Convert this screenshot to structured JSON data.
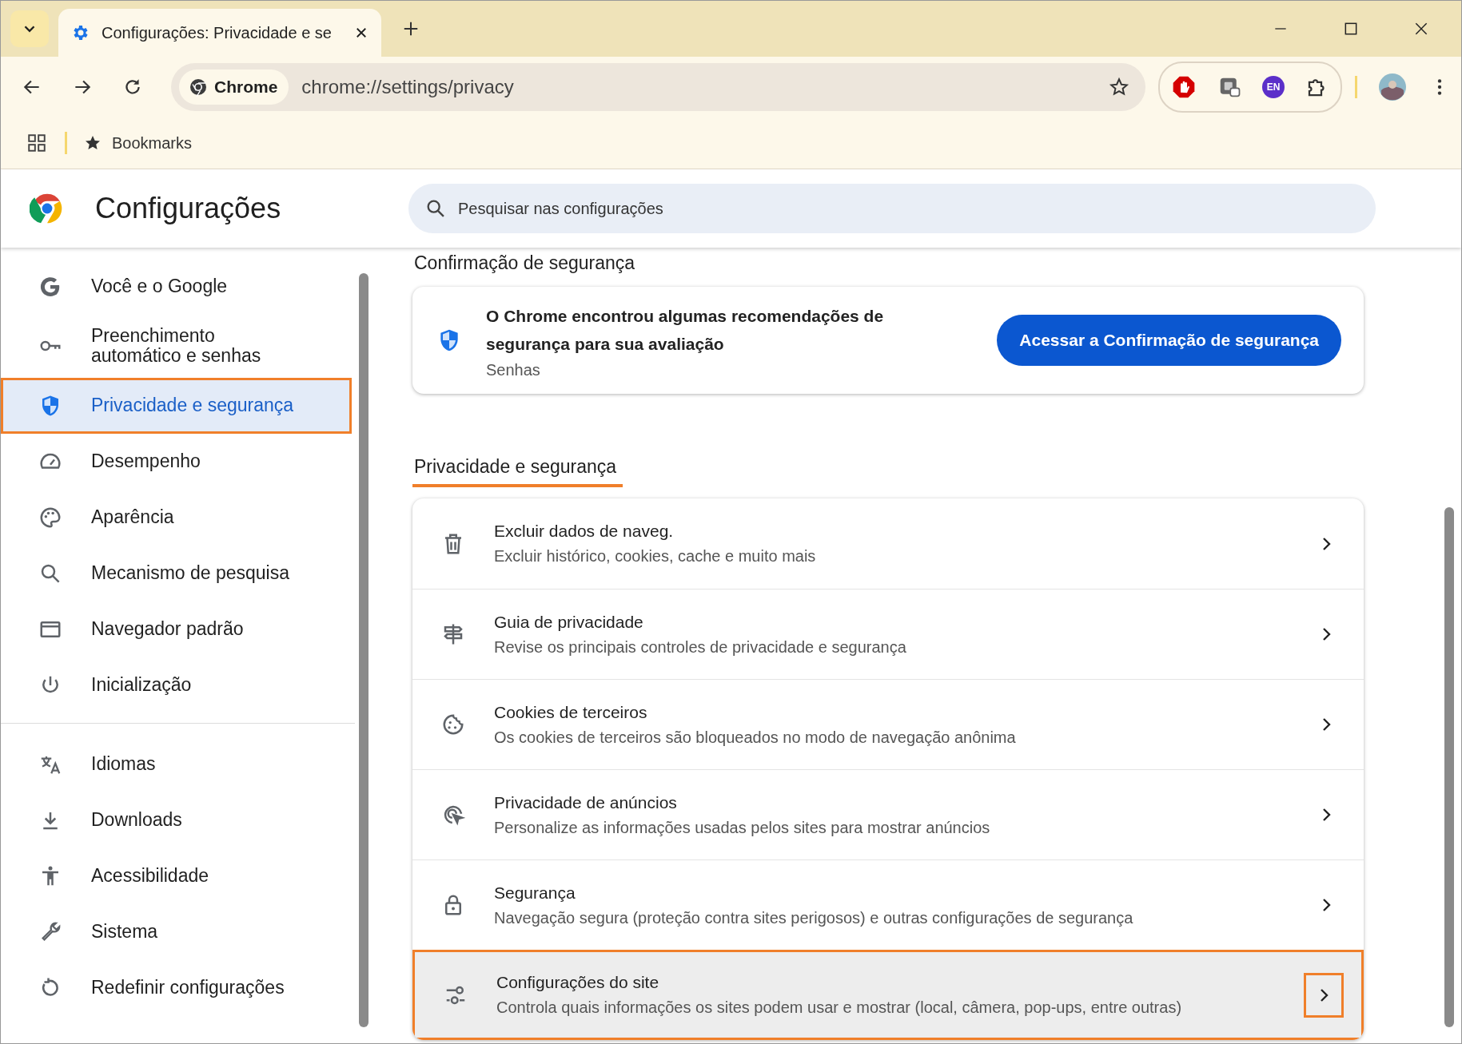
{
  "tab": {
    "title": "Configurações: Privacidade e se"
  },
  "toolbar": {
    "site_chip": "Chrome",
    "url": "chrome://settings/privacy",
    "language_badge": "EN"
  },
  "bookmarks_bar": {
    "label": "Bookmarks"
  },
  "header": {
    "title": "Configurações",
    "search": {
      "placeholder": "Pesquisar nas configurações"
    }
  },
  "sidebar": {
    "groups": [
      {
        "items": [
          {
            "label": "Você e o Google",
            "selected": false,
            "highlighted": false
          },
          {
            "label": "Preenchimento automático e senhas",
            "selected": false,
            "highlighted": false
          },
          {
            "label": "Privacidade e segurança",
            "selected": true,
            "highlighted": true
          },
          {
            "label": "Desempenho",
            "selected": false,
            "highlighted": false
          },
          {
            "label": "Aparência",
            "selected": false,
            "highlighted": false
          },
          {
            "label": "Mecanismo de pesquisa",
            "selected": false,
            "highlighted": false
          },
          {
            "label": "Navegador padrão",
            "selected": false,
            "highlighted": false
          },
          {
            "label": "Inicialização",
            "selected": false,
            "highlighted": false
          }
        ]
      },
      {
        "items": [
          {
            "label": "Idiomas",
            "selected": false,
            "highlighted": false
          },
          {
            "label": "Downloads",
            "selected": false,
            "highlighted": false
          },
          {
            "label": "Acessibilidade",
            "selected": false,
            "highlighted": false
          },
          {
            "label": "Sistema",
            "selected": false,
            "highlighted": false
          },
          {
            "label": "Redefinir configurações",
            "selected": false,
            "highlighted": false
          }
        ]
      }
    ]
  },
  "safety_check": {
    "heading": "Confirmação de segurança",
    "message": "O Chrome encontrou algumas recomendações de segurança para sua avaliação",
    "detail": "Senhas",
    "button": "Acessar a Confirmação de segurança"
  },
  "privacy_section": {
    "heading": "Privacidade e segurança",
    "underlined": true,
    "rows": [
      {
        "title": "Excluir dados de naveg.",
        "subtitle": "Excluir histórico, cookies, cache e muito mais",
        "highlighted": false
      },
      {
        "title": "Guia de privacidade",
        "subtitle": "Revise os principais controles de privacidade e segurança",
        "highlighted": false
      },
      {
        "title": "Cookies de terceiros",
        "subtitle": "Os cookies de terceiros são bloqueados no modo de navegação anônima",
        "highlighted": false
      },
      {
        "title": "Privacidade de anúncios",
        "subtitle": "Personalize as informações usadas pelos sites para mostrar anúncios",
        "highlighted": false
      },
      {
        "title": "Segurança",
        "subtitle": "Navegação segura (proteção contra sites perigosos) e outras configurações de segurança",
        "highlighted": false
      },
      {
        "title": "Configurações do site",
        "subtitle": "Controla quais informações os sites podem usar e mostrar (local, câmera, pop-ups, entre outras)",
        "highlighted": true
      }
    ]
  }
}
